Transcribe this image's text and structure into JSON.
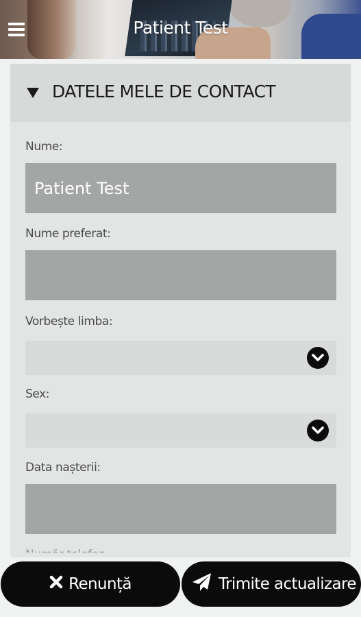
{
  "header": {
    "title": "Patient Test",
    "menu_icon": "hamburger-menu-icon"
  },
  "section": {
    "title": "DATELE MELE DE CONTACT",
    "expanded_icon": "triangle-down-icon"
  },
  "fields": {
    "nume": {
      "label": "Nume:",
      "value": "Patient Test"
    },
    "nume_preferat": {
      "label": "Nume preferat:",
      "value": ""
    },
    "vorbeste_limba": {
      "label": "Vorbește limba:",
      "selected": ""
    },
    "sex": {
      "label": "Sex:",
      "selected": ""
    },
    "data_nasterii": {
      "label": "Data nașterii:",
      "value": ""
    },
    "next_partial_label": "Număr telefon"
  },
  "buttons": {
    "cancel": {
      "label": "Renunță",
      "icon": "close-icon"
    },
    "send": {
      "label": "Trimite actualizare",
      "icon": "paper-plane-icon"
    }
  },
  "colors": {
    "card_background": "#e3e5e5",
    "section_header": "#d8dada",
    "input_fill": "#a4a6a6",
    "select_fill": "#d9dbdb",
    "button_fill": "#0b0b0b",
    "header_accent": "#3f5592"
  }
}
